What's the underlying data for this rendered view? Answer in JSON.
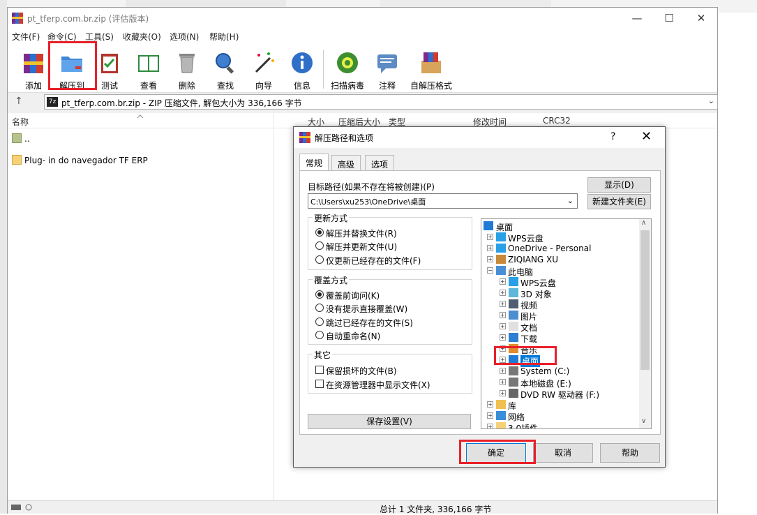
{
  "window": {
    "title": "pt_tferp.com.br.zip (评估版本)",
    "minimize": "—",
    "maximize": "☐",
    "close": "✕"
  },
  "menu": [
    "文件(F)",
    "命令(C)",
    "工具(S)",
    "收藏夹(O)",
    "选项(N)",
    "帮助(H)"
  ],
  "toolbar": {
    "add": "添加",
    "extract_to": "解压到",
    "test": "测试",
    "view": "查看",
    "delete": "删除",
    "find": "查找",
    "wizard": "向导",
    "info": "信息",
    "scan": "扫描病毒",
    "comment": "注释",
    "sfx": "自解压格式"
  },
  "address": {
    "up": "↑",
    "text": "pt_tferp.com.br.zip - ZIP 压缩文件, 解包大小为 336,166 字节",
    "dropdown": "⌄"
  },
  "columns": {
    "name": "名称",
    "size": "大小",
    "packed": "压缩后大小",
    "type": "类型",
    "modified": "修改时间",
    "crc": "CRC32"
  },
  "files": [
    {
      "name": ".."
    },
    {
      "name": "Plug- in do navegador TF ERP"
    }
  ],
  "status": {
    "text": "总计 1 文件夹, 336,166 字节"
  },
  "dialog": {
    "title": "解压路径和选项",
    "help_q": "?",
    "close": "✕",
    "tabs": [
      "常规",
      "高级",
      "选项"
    ],
    "dest_label": "目标路径(如果不存在将被创建)(P)",
    "dest_value": "C:\\Users\\xu253\\OneDrive\\桌面",
    "show_btn": "显示(D)",
    "new_folder_btn": "新建文件夹(E)",
    "update_group": "更新方式",
    "update_opts": [
      "解压并替换文件(R)",
      "解压并更新文件(U)",
      "仅更新已经存在的文件(F)"
    ],
    "update_selected": 0,
    "overwrite_group": "覆盖方式",
    "overwrite_opts": [
      "覆盖前询问(K)",
      "没有提示直接覆盖(W)",
      "跳过已经存在的文件(S)",
      "自动重命名(N)"
    ],
    "overwrite_selected": 0,
    "other_group": "其它",
    "other_opts": [
      "保留损坏的文件(B)",
      "在资源管理器中显示文件(X)"
    ],
    "save_btn": "保存设置(V)",
    "ok_btn": "确定",
    "cancel_btn": "取消",
    "help_btn": "帮助",
    "tree": [
      {
        "label": "桌面",
        "level": 0,
        "icon": "desktop"
      },
      {
        "label": "WPS云盘",
        "level": 1,
        "icon": "cloud"
      },
      {
        "label": "OneDrive - Personal",
        "level": 1,
        "icon": "cloud"
      },
      {
        "label": "ZIQIANG XU",
        "level": 1,
        "icon": "user"
      },
      {
        "label": "此电脑",
        "level": 1,
        "icon": "pc",
        "expanded": true
      },
      {
        "label": "WPS云盘",
        "level": 2,
        "icon": "cloud"
      },
      {
        "label": "3D 对象",
        "level": 2,
        "icon": "cube"
      },
      {
        "label": "视频",
        "level": 2,
        "icon": "video"
      },
      {
        "label": "图片",
        "level": 2,
        "icon": "picture"
      },
      {
        "label": "文档",
        "level": 2,
        "icon": "doc"
      },
      {
        "label": "下载",
        "level": 2,
        "icon": "download"
      },
      {
        "label": "音乐",
        "level": 2,
        "icon": "music"
      },
      {
        "label": "桌面",
        "level": 2,
        "icon": "desktop",
        "selected": true
      },
      {
        "label": "System (C:)",
        "level": 2,
        "icon": "drive"
      },
      {
        "label": "本地磁盘 (E:)",
        "level": 2,
        "icon": "drive"
      },
      {
        "label": "DVD RW 驱动器 (F:)",
        "level": 2,
        "icon": "dvd"
      },
      {
        "label": "库",
        "level": 1,
        "icon": "library"
      },
      {
        "label": "网络",
        "level": 1,
        "icon": "network"
      },
      {
        "label": "3.0插件",
        "level": 1,
        "icon": "folder"
      }
    ]
  },
  "colors": {
    "highlight": "#e8202a",
    "selection": "#0078d7"
  }
}
